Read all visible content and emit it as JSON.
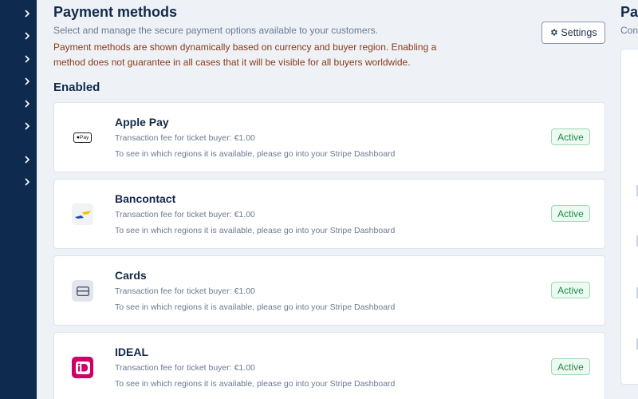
{
  "sidebar": {
    "chevrons": [
      "chevron-right",
      "chevron-right",
      "chevron-right",
      "chevron-right",
      "chevron-right",
      "chevron-right",
      "chevron-right",
      "chevron-right"
    ]
  },
  "header": {
    "title": "Payment methods",
    "subtitle": "Select and manage the secure payment options available to your customers.",
    "warning": "Payment methods are shown dynamically based on currency and buyer region. Enabling a method does not guarantee in all cases that it will be visible for all buyers worldwide.",
    "settings_label": "Settings",
    "settings_icon": "gear-icon"
  },
  "enabled": {
    "title": "Enabled",
    "methods": [
      {
        "name": "Apple Pay",
        "fee": "Transaction fee for ticket buyer: €1.00",
        "region_note": "To see in which regions it is available, please go into your Stripe Dashboard",
        "status": "Active",
        "logo_text": "Pay",
        "icon": "apple-pay-icon"
      },
      {
        "name": "Bancontact",
        "fee": "Transaction fee for ticket buyer: €1.00",
        "region_note": "To see in which regions it is available, please go into your Stripe Dashboard",
        "status": "Active",
        "icon": "bancontact-icon"
      },
      {
        "name": "Cards",
        "fee": "Transaction fee for ticket buyer: €1.00",
        "region_note": "To see in which regions it is available, please go into your Stripe Dashboard",
        "status": "Active",
        "icon": "credit-card-icon"
      },
      {
        "name": "IDEAL",
        "fee": "Transaction fee for ticket buyer: €1.00",
        "region_note": "To see in which regions it is available, please go into your Stripe Dashboard",
        "status": "Active",
        "icon": "ideal-icon"
      }
    ]
  },
  "right_column": {
    "title_fragment": "Pay",
    "subtitle_fragment": "Con"
  },
  "colors": {
    "sidebar": "#0f2a4f",
    "background": "#eef2f7",
    "title": "#14294a",
    "warning": "#8a3a1a",
    "active_badge": "#1f8a4c",
    "ideal_brand": "#cc0066"
  }
}
